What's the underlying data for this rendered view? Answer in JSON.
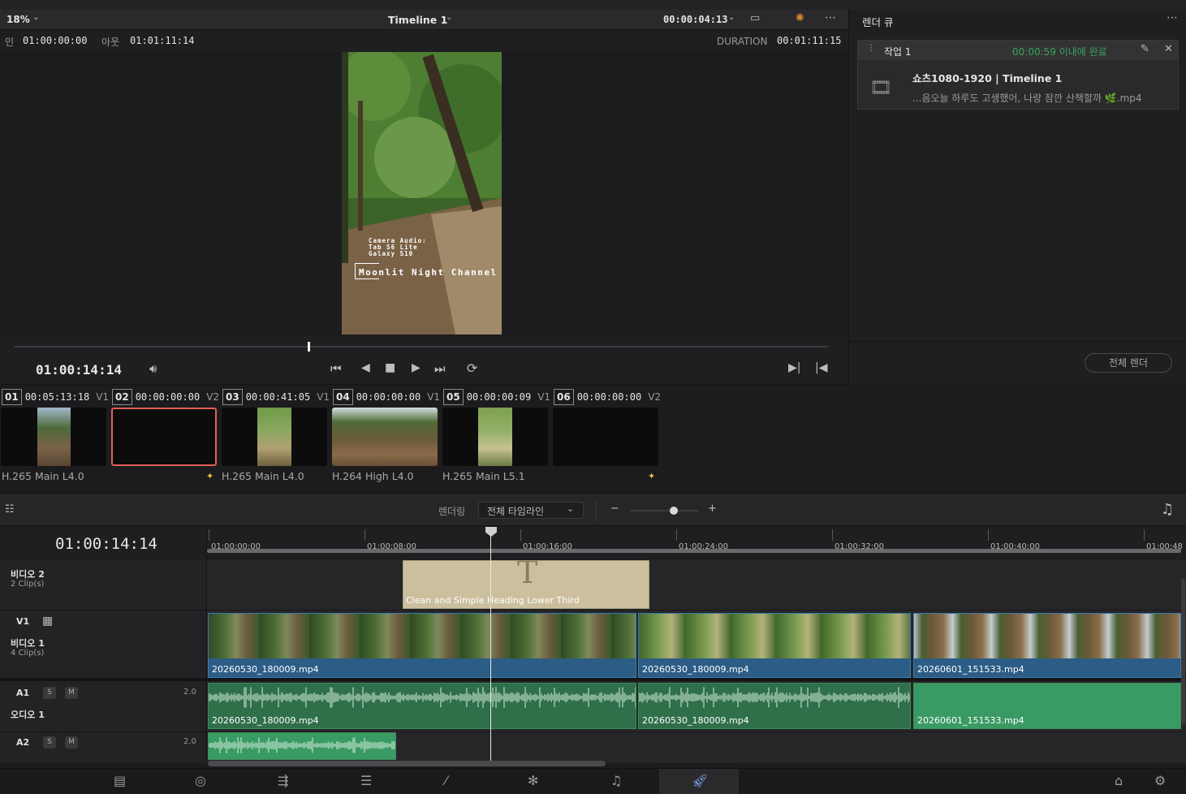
{
  "viewer": {
    "zoom": "18%",
    "timeline_name": "Timeline 1",
    "timecode_top": "00:00:04:13",
    "in_label": "인",
    "in_value": "01:00:00:00",
    "out_label": "아웃",
    "out_value": "01:01:11:14",
    "duration_label": "DURATION",
    "duration_value": "00:01:11:15",
    "overlay_line1": "Camera Audio:",
    "overlay_line2": "Tab S6 Lite",
    "overlay_line3": "Galaxy S10",
    "overlay_title": "Moonlit Night Channel",
    "current_timecode": "01:00:14:14",
    "playhead_progress": 0.36
  },
  "render_queue": {
    "title": "렌더 큐",
    "job_name": "작업 1",
    "job_status": "00:00:59 이내에 완료",
    "job_preset": "쇼츠1080-1920 | Timeline 1",
    "job_file": "...음오늘 하루도 고생했어, 나랑 잠깐 산책할까 🌿.mp4",
    "render_all": "전체 렌더"
  },
  "clips": [
    {
      "num": "01",
      "tc": "00:05:13:18",
      "track": "V1",
      "codec": "H.265 Main L4.0"
    },
    {
      "num": "02",
      "tc": "00:00:00:00",
      "track": "V2",
      "codec": ""
    },
    {
      "num": "03",
      "tc": "00:00:41:05",
      "track": "V1",
      "codec": "H.265 Main L4.0"
    },
    {
      "num": "04",
      "tc": "00:00:00:00",
      "track": "V1",
      "codec": "H.264 High L4.0"
    },
    {
      "num": "05",
      "tc": "00:00:00:09",
      "track": "V1",
      "codec": "H.265 Main L5.1"
    },
    {
      "num": "06",
      "tc": "00:00:00:00",
      "track": "V2",
      "codec": ""
    }
  ],
  "timeline_toolbar": {
    "render_label": "렌더링",
    "render_range": "전체 타임라인",
    "zoom_minus": "−",
    "zoom_plus": "+"
  },
  "timeline": {
    "current_timecode": "01:00:14:14",
    "ruler_ticks": [
      "01:00:00:00",
      "01:00:08:00",
      "01:00:16:00",
      "01:00:24:00",
      "01:00:32:00",
      "01:00:40:00",
      "01:00:48"
    ],
    "tracks": {
      "v2_name": "비디오 2",
      "v2_clips": "2 Clip(s)",
      "v1_label": "V1",
      "v1_name": "비디오 1",
      "v1_clips": "4 Clip(s)",
      "a1_label": "A1",
      "a1_name": "오디오 1",
      "a1_level": "2.0",
      "a2_label": "A2",
      "a2_level": "2.0",
      "solo": "S",
      "mute": "M"
    },
    "title_clip": "Clean and Simple Heading Lower Third",
    "video_clips": [
      "20260530_180009.mp4",
      "20260530_180009.mp4",
      "20260601_151533.mp4"
    ],
    "audio_clips": [
      "20260530_180009.mp4",
      "20260530_180009.mp4",
      "20260601_151533.mp4"
    ]
  },
  "colors": {
    "accent_green": "#2f6f4a",
    "video_blue": "#2c5d86",
    "status_green": "#3aa55c",
    "selected_red": "#e0605a"
  },
  "icons": [
    "volume-icon",
    "skip-back-icon",
    "step-back-icon",
    "stop-icon",
    "play-icon",
    "skip-forward-icon",
    "loop-icon",
    "mark-in-icon",
    "mark-out-icon",
    "edit-icon",
    "close-icon",
    "music-icon",
    "home-icon",
    "settings-icon"
  ]
}
